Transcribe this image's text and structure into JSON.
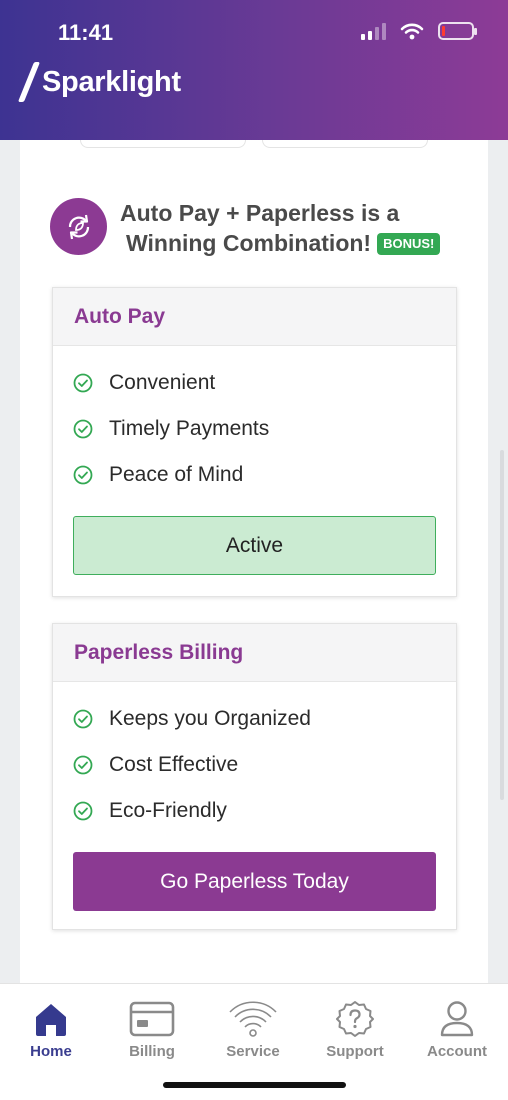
{
  "status_bar": {
    "time": "11:41"
  },
  "header": {
    "brand": "Sparklight"
  },
  "promo": {
    "title_line1": "Auto Pay + Paperless is a",
    "title_line2": "Winning Combination!",
    "badge": "BONUS!"
  },
  "autopay_card": {
    "title": "Auto Pay",
    "benefits": [
      "Convenient",
      "Timely Payments",
      "Peace of Mind"
    ],
    "status_button": "Active"
  },
  "paperless_card": {
    "title": "Paperless Billing",
    "benefits": [
      "Keeps you Organized",
      "Cost Effective",
      "Eco-Friendly"
    ],
    "cta_button": "Go Paperless Today"
  },
  "bottom_nav": {
    "items": [
      {
        "label": "Home",
        "icon": "home-icon",
        "active": true
      },
      {
        "label": "Billing",
        "icon": "credit-card-icon",
        "active": false
      },
      {
        "label": "Service",
        "icon": "wifi-icon",
        "active": false
      },
      {
        "label": "Support",
        "icon": "help-icon",
        "active": false
      },
      {
        "label": "Account",
        "icon": "user-icon",
        "active": false
      }
    ]
  },
  "colors": {
    "brand_purple": "#8b3a92",
    "header_gradient_start": "#3d3392",
    "success_green": "#33a853",
    "active_fill": "#cbebd2",
    "nav_active": "#3a3d8f"
  }
}
